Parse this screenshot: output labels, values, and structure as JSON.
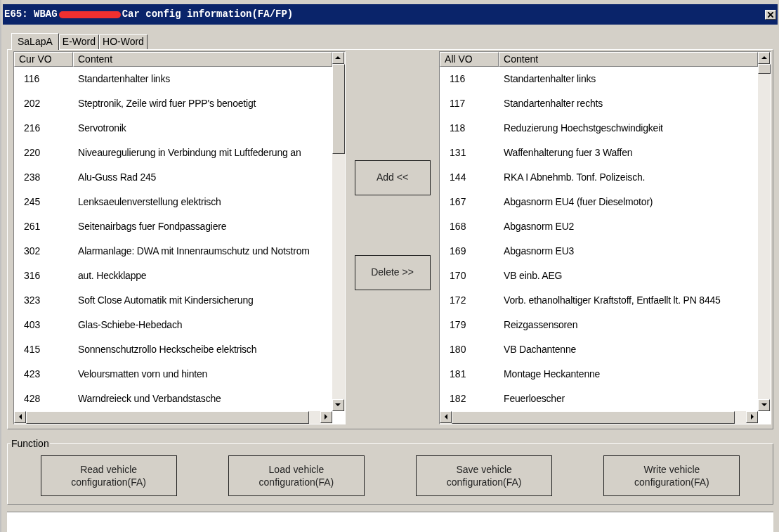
{
  "window": {
    "title_prefix": "E65: WBAG",
    "title": "Car config information(FA/FP)"
  },
  "tabs": [
    {
      "label": "SaLapA",
      "selected": true
    },
    {
      "label": "E-Word",
      "selected": false
    },
    {
      "label": "HO-Word",
      "selected": false
    }
  ],
  "left_list": {
    "columns": [
      "Cur VO",
      "Content"
    ],
    "rows": [
      {
        "code": "116",
        "content": "Standartenhalter links"
      },
      {
        "code": "202",
        "content": "Steptronik, Zeile wird fuer PPP's benoetigt"
      },
      {
        "code": "216",
        "content": "Servotronik"
      },
      {
        "code": "220",
        "content": "Niveauregulierung in Verbindung mit Luftfederung an"
      },
      {
        "code": "238",
        "content": "Alu-Guss Rad 245"
      },
      {
        "code": "245",
        "content": "Lenksaeulenverstellung elektrisch"
      },
      {
        "code": "261",
        "content": "Seitenairbags fuer Fondpassagiere"
      },
      {
        "code": "302",
        "content": "Alarmanlage: DWA mit Innenraumschutz und Notstrom"
      },
      {
        "code": "316",
        "content": "aut. Heckklappe"
      },
      {
        "code": "323",
        "content": "Soft Close Automatik mit Kindersicherung"
      },
      {
        "code": "403",
        "content": "Glas-Schiebe-Hebedach"
      },
      {
        "code": "415",
        "content": "Sonnenschutzrollo Heckscheibe elektrisch"
      },
      {
        "code": "423",
        "content": "Veloursmatten vorn und hinten"
      },
      {
        "code": "428",
        "content": "Warndreieck und Verbandstasche"
      }
    ]
  },
  "transfer_buttons": [
    "Add <<",
    "Delete >>"
  ],
  "right_list": {
    "columns": [
      "All VO",
      "Content"
    ],
    "rows": [
      {
        "code": "116",
        "content": "Standartenhalter links"
      },
      {
        "code": "117",
        "content": "Standartenhalter rechts"
      },
      {
        "code": "118",
        "content": "Reduzierung Hoechstgeschwindigkeit"
      },
      {
        "code": "131",
        "content": "Waffenhalterung fuer 3 Waffen"
      },
      {
        "code": "144",
        "content": "RKA I Abnehmb. Tonf. Polizeisch."
      },
      {
        "code": "167",
        "content": "Abgasnorm EU4 (fuer Dieselmotor)"
      },
      {
        "code": "168",
        "content": "Abgasnorm EU2"
      },
      {
        "code": "169",
        "content": "Abgasnorm EU3"
      },
      {
        "code": "170",
        "content": "VB einb. AEG"
      },
      {
        "code": "172",
        "content": "Vorb. ethanolhaltiger Kraftstoff, Entfaellt lt. PN 8445"
      },
      {
        "code": "179",
        "content": "Reizgassensoren"
      },
      {
        "code": "180",
        "content": "VB Dachantenne"
      },
      {
        "code": "181",
        "content": "Montage Heckantenne"
      },
      {
        "code": "182",
        "content": "Feuerloescher"
      }
    ]
  },
  "function_group": {
    "title": "Function",
    "buttons": [
      "Read vehicle configuration(FA)",
      "Load vehicle configuration(FA)",
      "Save vehicle configuration(FA)",
      "Write vehicle configuration(FA)"
    ]
  }
}
